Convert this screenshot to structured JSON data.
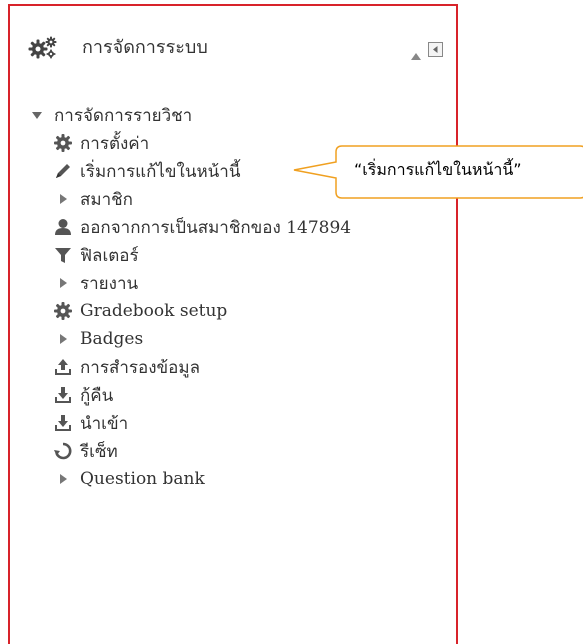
{
  "block": {
    "title": "การจัดการระบบ",
    "header_icon": "gears-icon",
    "collapse_icon": "collapse-up-icon",
    "dock_icon": "dock-icon"
  },
  "tree": {
    "root_label": "การจัดการรายวิชา",
    "items": [
      {
        "label": "การตั้งค่า",
        "icon": "gear-icon"
      },
      {
        "label": "เริ่มการแก้ไขในหน้านี้",
        "icon": "pencil-icon"
      },
      {
        "label": "สมาชิก",
        "icon": "expand-arrow-icon"
      },
      {
        "label": "ออกจากการเป็นสมาชิกของ 147894",
        "icon": "user-icon"
      },
      {
        "label": "ฟิลเตอร์",
        "icon": "filter-icon"
      },
      {
        "label": "รายงาน",
        "icon": "expand-arrow-icon"
      },
      {
        "label": "Gradebook setup",
        "icon": "gear-icon"
      },
      {
        "label": "Badges",
        "icon": "expand-arrow-icon"
      },
      {
        "label": "การสำรองข้อมูล",
        "icon": "upload-icon"
      },
      {
        "label": "กู้คืน",
        "icon": "download-icon"
      },
      {
        "label": "นำเข้า",
        "icon": "download-icon"
      },
      {
        "label": "รีเซ็ท",
        "icon": "reset-icon"
      },
      {
        "label": "Question bank",
        "icon": "expand-arrow-icon"
      }
    ]
  },
  "callout": {
    "text": "“เริ่มการแก้ไขในหน้านี้”"
  },
  "colors": {
    "border": "#d8232a",
    "callout_border": "#f0a020",
    "icon": "#555555",
    "text": "#333333"
  }
}
